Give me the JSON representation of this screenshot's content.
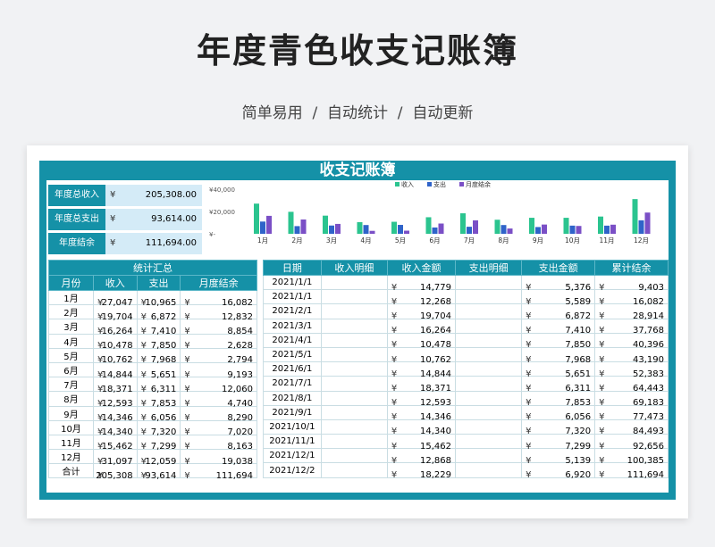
{
  "header": {
    "title": "年度青色收支记账簿",
    "subtitle": "简单易用  /  自动统计  /  自动更新"
  },
  "sheet": {
    "title": "收支记账簿",
    "summary": [
      {
        "label": "年度总收入",
        "currency": "¥",
        "value": "205,308.00"
      },
      {
        "label": "年度总支出",
        "currency": "¥",
        "value": "93,614.00"
      },
      {
        "label": "年度结余",
        "currency": "¥",
        "value": "111,694.00"
      }
    ]
  },
  "chart_data": {
    "type": "bar",
    "categories": [
      "1月",
      "2月",
      "3月",
      "4月",
      "5月",
      "6月",
      "7月",
      "8月",
      "9月",
      "10月",
      "11月",
      "12月"
    ],
    "series": [
      {
        "name": "收入",
        "color": "#2bc48f",
        "values": [
          27047,
          19704,
          16264,
          10478,
          10762,
          14844,
          18371,
          12593,
          14346,
          14340,
          15462,
          31097
        ]
      },
      {
        "name": "支出",
        "color": "#2f63c9",
        "values": [
          10965,
          6872,
          7410,
          7850,
          7968,
          5651,
          6311,
          7853,
          6056,
          7320,
          7299,
          12059
        ]
      },
      {
        "name": "月度结余",
        "color": "#7a4fc6",
        "values": [
          16082,
          12832,
          8854,
          2628,
          2794,
          9193,
          12060,
          4740,
          8290,
          7020,
          8163,
          19038
        ]
      }
    ],
    "yticks": [
      "¥40,000",
      "¥20,000",
      "¥-"
    ],
    "ylim": [
      0,
      40000
    ],
    "legend": "top"
  },
  "stats": {
    "title": "统计汇总",
    "columns": [
      "月份",
      "收入",
      "支出",
      "月度结余"
    ],
    "currency": "¥",
    "rows": [
      [
        "1月",
        "27,047",
        "10,965",
        "16,082"
      ],
      [
        "2月",
        "19,704",
        "6,872",
        "12,832"
      ],
      [
        "3月",
        "16,264",
        "7,410",
        "8,854"
      ],
      [
        "4月",
        "10,478",
        "7,850",
        "2,628"
      ],
      [
        "5月",
        "10,762",
        "7,968",
        "2,794"
      ],
      [
        "6月",
        "14,844",
        "5,651",
        "9,193"
      ],
      [
        "7月",
        "18,371",
        "6,311",
        "12,060"
      ],
      [
        "8月",
        "12,593",
        "7,853",
        "4,740"
      ],
      [
        "9月",
        "14,346",
        "6,056",
        "8,290"
      ],
      [
        "10月",
        "14,340",
        "7,320",
        "7,020"
      ],
      [
        "11月",
        "15,462",
        "7,299",
        "8,163"
      ],
      [
        "12月",
        "31,097",
        "12,059",
        "19,038"
      ],
      [
        "合计",
        "205,308",
        "93,614",
        "111,694"
      ]
    ]
  },
  "ledger": {
    "columns": [
      "日期",
      "收入明细",
      "收入金额",
      "支出明细",
      "支出金额",
      "累计结余"
    ],
    "currency": "¥",
    "rows": [
      [
        "2021/1/1",
        "",
        "14,779",
        "",
        "5,376",
        "9,403"
      ],
      [
        "2021/1/1",
        "",
        "12,268",
        "",
        "5,589",
        "16,082"
      ],
      [
        "2021/2/1",
        "",
        "19,704",
        "",
        "6,872",
        "28,914"
      ],
      [
        "2021/3/1",
        "",
        "16,264",
        "",
        "7,410",
        "37,768"
      ],
      [
        "2021/4/1",
        "",
        "10,478",
        "",
        "7,850",
        "40,396"
      ],
      [
        "2021/5/1",
        "",
        "10,762",
        "",
        "7,968",
        "43,190"
      ],
      [
        "2021/6/1",
        "",
        "14,844",
        "",
        "5,651",
        "52,383"
      ],
      [
        "2021/7/1",
        "",
        "18,371",
        "",
        "6,311",
        "64,443"
      ],
      [
        "2021/8/1",
        "",
        "12,593",
        "",
        "7,853",
        "69,183"
      ],
      [
        "2021/9/1",
        "",
        "14,346",
        "",
        "6,056",
        "77,473"
      ],
      [
        "2021/10/1",
        "",
        "14,340",
        "",
        "7,320",
        "84,493"
      ],
      [
        "2021/11/1",
        "",
        "15,462",
        "",
        "7,299",
        "92,656"
      ],
      [
        "2021/12/1",
        "",
        "12,868",
        "",
        "5,139",
        "100,385"
      ],
      [
        "2021/12/2",
        "",
        "18,229",
        "",
        "6,920",
        "111,694"
      ]
    ]
  }
}
